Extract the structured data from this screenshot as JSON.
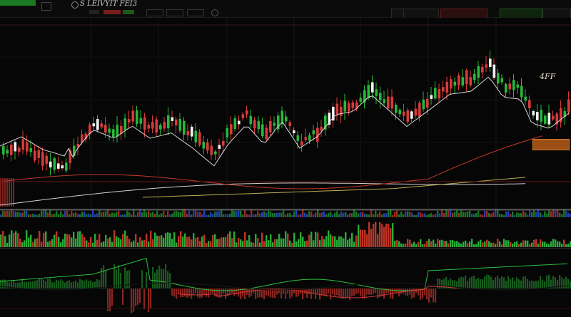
{
  "header": {
    "symbol_box": "",
    "logo_text": "S LEIVYIT FEI3",
    "stat_red": "",
    "stat_green": "",
    "tool_labels": [
      "",
      ""
    ],
    "right_pills": [
      "",
      "",
      "",
      "",
      "",
      "",
      "",
      ""
    ]
  },
  "main_chart": {
    "ticker_label": "4FF",
    "price_badge": "",
    "overlay_left": ""
  },
  "volume_panel": {
    "labels": [
      "",
      "",
      ""
    ],
    "right_label": ""
  },
  "indicator_panel": {
    "labels": [
      "",
      "",
      ""
    ],
    "right_label": ""
  },
  "colors": {
    "bull": "#27b83a",
    "bear": "#d73a3a",
    "price_badge": "#9b4f16",
    "ma_line": "#d8d8d8",
    "ma_red": "#c0392b"
  }
}
